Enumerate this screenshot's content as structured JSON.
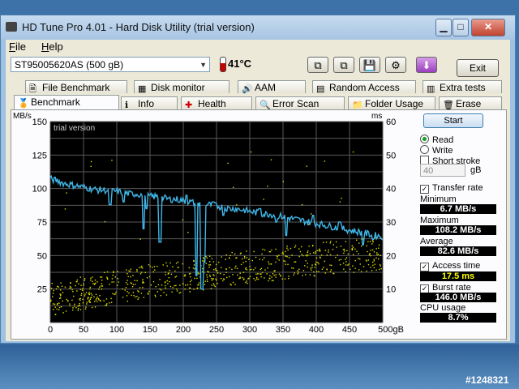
{
  "window": {
    "title": "HD Tune Pro 4.01 - Hard Disk Utility (trial version)"
  },
  "menu": {
    "file": "File",
    "help": "Help"
  },
  "drive": {
    "name": "ST95005620AS (500 gB)",
    "temperature": "41"
  },
  "toolbar": {
    "exit_label": "Exit"
  },
  "tabs_row1": [
    "File Benchmark",
    "Disk monitor",
    "AAM",
    "Random Access",
    "Extra tests"
  ],
  "tabs_row2": [
    "Benchmark",
    "Info",
    "Health",
    "Error Scan",
    "Folder Usage",
    "Erase"
  ],
  "chart_data": {
    "type": "line",
    "watermark": "trial version",
    "y_left_unit": "MB/s",
    "y_right_unit": "ms",
    "y_left_ticks": [
      25,
      50,
      75,
      100,
      125,
      150
    ],
    "y_right_ticks": [
      10,
      20,
      30,
      40,
      50,
      60
    ],
    "x_ticks": [
      "0",
      "50",
      "100",
      "150",
      "200",
      "250",
      "300",
      "350",
      "400",
      "450",
      "500gB"
    ],
    "xlim": [
      0,
      500
    ],
    "ylim_left": [
      0,
      150
    ],
    "ylim_right": [
      0,
      60
    ],
    "grid": true,
    "series": [
      {
        "color": "#3fb6e8",
        "x": [
          0,
          10,
          20,
          30,
          40,
          50,
          60,
          70,
          80,
          90,
          100,
          110,
          120,
          130,
          140,
          150,
          160,
          170,
          180,
          190,
          200,
          210,
          220,
          230,
          240,
          250,
          260,
          270,
          280,
          290,
          300,
          310,
          320,
          330,
          340,
          350,
          360,
          370,
          380,
          390,
          400,
          410,
          420,
          430,
          440,
          450,
          460,
          470,
          480,
          490,
          500
        ],
        "y": [
          107,
          106,
          104,
          103,
          102,
          101,
          100,
          99,
          99,
          98,
          98,
          97,
          96,
          96,
          95,
          94,
          94,
          93,
          92,
          92,
          91,
          90,
          89,
          88,
          88,
          87,
          86,
          85,
          85,
          84,
          83,
          82,
          81,
          81,
          80,
          79,
          78,
          77,
          76,
          75,
          74,
          73,
          72,
          71,
          70,
          69,
          68,
          67,
          66,
          65,
          64
        ]
      }
    ],
    "dips": [
      [
        90,
        88
      ],
      [
        110,
        90
      ],
      [
        140,
        70
      ],
      [
        145,
        85
      ],
      [
        165,
        60
      ],
      [
        205,
        95
      ],
      [
        220,
        35
      ],
      [
        228,
        25
      ],
      [
        232,
        45
      ],
      [
        245,
        90
      ],
      [
        260,
        80
      ],
      [
        315,
        85
      ],
      [
        340,
        75
      ],
      [
        355,
        65
      ],
      [
        395,
        80
      ],
      [
        435,
        75
      ],
      [
        470,
        58
      ],
      [
        485,
        62
      ]
    ],
    "access_scatter_color": "#e0e000",
    "access_scatter_trend_ms": [
      [
        0,
        7
      ],
      [
        100,
        11
      ],
      [
        200,
        14
      ],
      [
        300,
        17
      ],
      [
        400,
        19
      ],
      [
        500,
        21
      ]
    ]
  },
  "controls": {
    "start": "Start",
    "read": "Read",
    "write": "Write",
    "short_stroke": "Short stroke",
    "stroke_value": "40",
    "stroke_unit": "gB",
    "transfer_rate": "Transfer rate",
    "minimum_label": "Minimum",
    "minimum_value": "6.7 MB/s",
    "maximum_label": "Maximum",
    "maximum_value": "108.2 MB/s",
    "average_label": "Average",
    "average_value": "82.6 MB/s",
    "access_time": "Access time",
    "access_value": "17.5 ms",
    "burst_rate": "Burst rate",
    "burst_value": "146.0 MB/s",
    "cpu_label": "CPU usage",
    "cpu_value": "8.7%"
  },
  "footer_id": "#1248321"
}
